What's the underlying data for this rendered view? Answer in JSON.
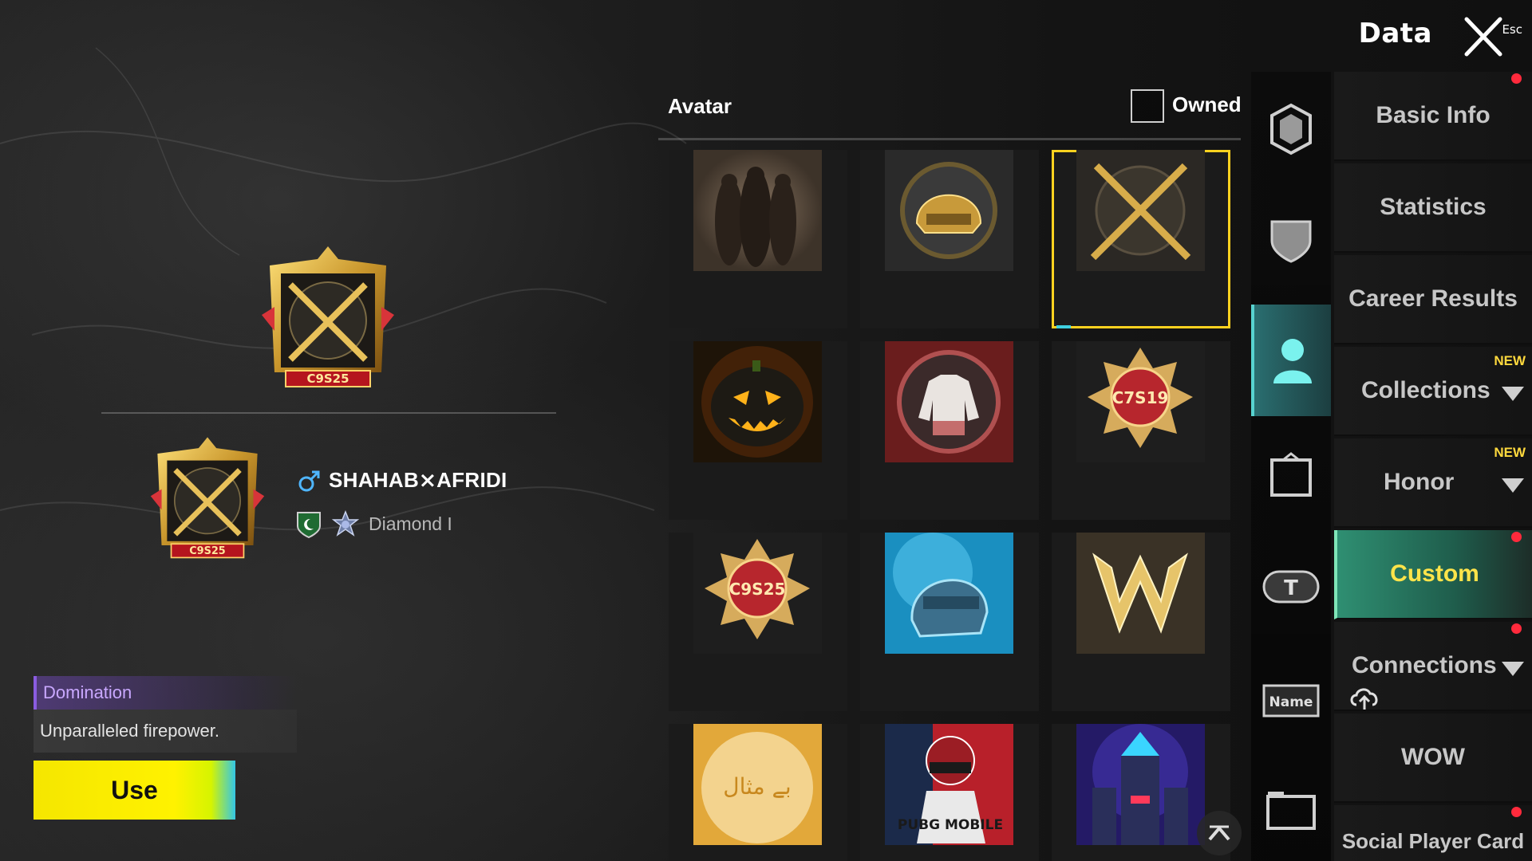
{
  "header": {
    "title": "Data",
    "esc_label": "Esc"
  },
  "profile": {
    "badge_text": "C9S25",
    "player_name": "SHAHAB⨯AFRIDI",
    "rank": "Diamond I"
  },
  "item_info": {
    "title": "Domination",
    "description": "Unparalleled firepower.",
    "use_label": "Use"
  },
  "avatar_panel": {
    "title": "Avatar",
    "owned_label": "Owned",
    "owned_checked": false,
    "items": [
      {
        "name": "squad-silhouette"
      },
      {
        "name": "gold-helmet"
      },
      {
        "name": "crossed-rifles",
        "selected": true
      },
      {
        "name": "jack-o-lantern"
      },
      {
        "name": "jacket-emblem"
      },
      {
        "name": "c7s19-badge",
        "badge_text": "C7S19"
      },
      {
        "name": "c9s25-badge",
        "badge_text": "C9S25"
      },
      {
        "name": "blue-helmet"
      },
      {
        "name": "gold-w-logo"
      },
      {
        "name": "golden-calligraphy",
        "text": "بے مثال"
      },
      {
        "name": "pubg-mobile-character",
        "text": "PUBG MOBILE"
      },
      {
        "name": "neon-castle"
      }
    ]
  },
  "side_icons": [
    {
      "name": "frame-icon"
    },
    {
      "name": "shield-icon"
    },
    {
      "name": "avatar-icon",
      "active": true
    },
    {
      "name": "outfit-icon"
    },
    {
      "name": "title-icon",
      "text": "T"
    },
    {
      "name": "nameplate-icon",
      "text": "Name"
    },
    {
      "name": "folder-icon"
    }
  ],
  "menu": {
    "items": [
      {
        "label": "Basic Info"
      },
      {
        "label": "Statistics"
      },
      {
        "label": "Career Results"
      },
      {
        "label": "Collections",
        "badge": "NEW"
      },
      {
        "label": "Honor",
        "badge": "NEW"
      },
      {
        "label": "Custom",
        "active": true
      },
      {
        "label": "Connections"
      },
      {
        "label": "WOW"
      },
      {
        "label": "Social Player Card"
      }
    ]
  },
  "colors": {
    "accent": "#ffd21f",
    "active_menu": "#2f8f72",
    "use_button": "#fff200",
    "notify": "#ff2a3c"
  }
}
